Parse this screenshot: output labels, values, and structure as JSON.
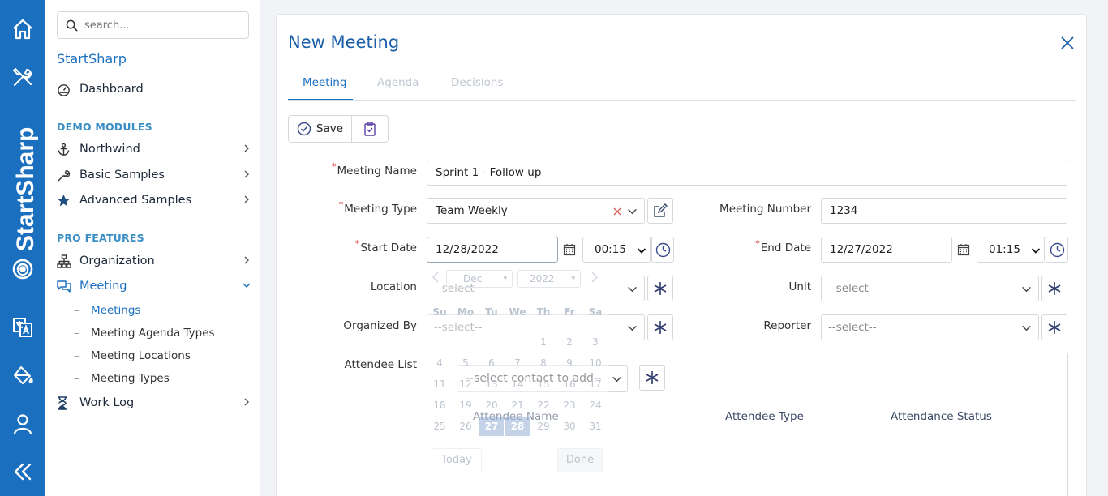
{
  "rail": {
    "brand_text": "StartSharp"
  },
  "sidebar": {
    "search_placeholder": "search...",
    "brand": "StartSharp",
    "dashboard": "Dashboard",
    "demo_header": "DEMO MODULES",
    "northwind": "Northwind",
    "basic_samples": "Basic Samples",
    "advanced_samples": "Advanced Samples",
    "pro_header": "PRO FEATURES",
    "organization": "Organization",
    "meeting": "Meeting",
    "meeting_items": [
      "Meetings",
      "Meeting Agenda Types",
      "Meeting Locations",
      "Meeting Types"
    ],
    "work_log": "Work Log"
  },
  "dialog": {
    "title": "New Meeting",
    "tabs": [
      "Meeting",
      "Agenda",
      "Decisions"
    ],
    "save_label": "Save",
    "labels": {
      "meeting_name": "Meeting Name",
      "meeting_type": "Meeting Type",
      "meeting_number": "Meeting Number",
      "start_date": "Start Date",
      "end_date": "End Date",
      "location": "Location",
      "unit": "Unit",
      "organized_by": "Organized By",
      "reporter": "Reporter",
      "attendee_list": "Attendee List"
    },
    "values": {
      "meeting_name": "Sprint 1 - Follow up",
      "meeting_type": "Team Weekly",
      "meeting_number": "1234",
      "start_date": "12/28/2022",
      "start_time": "00:15",
      "end_date": "12/27/2022",
      "end_time": "01:15",
      "select_placeholder": "--select--",
      "contact_placeholder": "--select contact to add--"
    },
    "attendee_columns": [
      "Attendee Name",
      "Attendee Type",
      "Attendance Status"
    ],
    "datepicker": {
      "month": "Dec",
      "year": "2022",
      "weekdays": [
        "Su",
        "Mo",
        "Tu",
        "We",
        "Th",
        "Fr",
        "Sa"
      ],
      "weeks": [
        [
          "",
          "",
          "",
          "",
          "1",
          "2",
          "3"
        ],
        [
          "4",
          "5",
          "6",
          "7",
          "8",
          "9",
          "10"
        ],
        [
          "11",
          "12",
          "13",
          "14",
          "15",
          "16",
          "17"
        ],
        [
          "18",
          "19",
          "20",
          "21",
          "22",
          "23",
          "24"
        ],
        [
          "25",
          "26",
          "27",
          "28",
          "29",
          "30",
          "31"
        ]
      ],
      "today_label": "Today",
      "done_label": "Done"
    }
  }
}
